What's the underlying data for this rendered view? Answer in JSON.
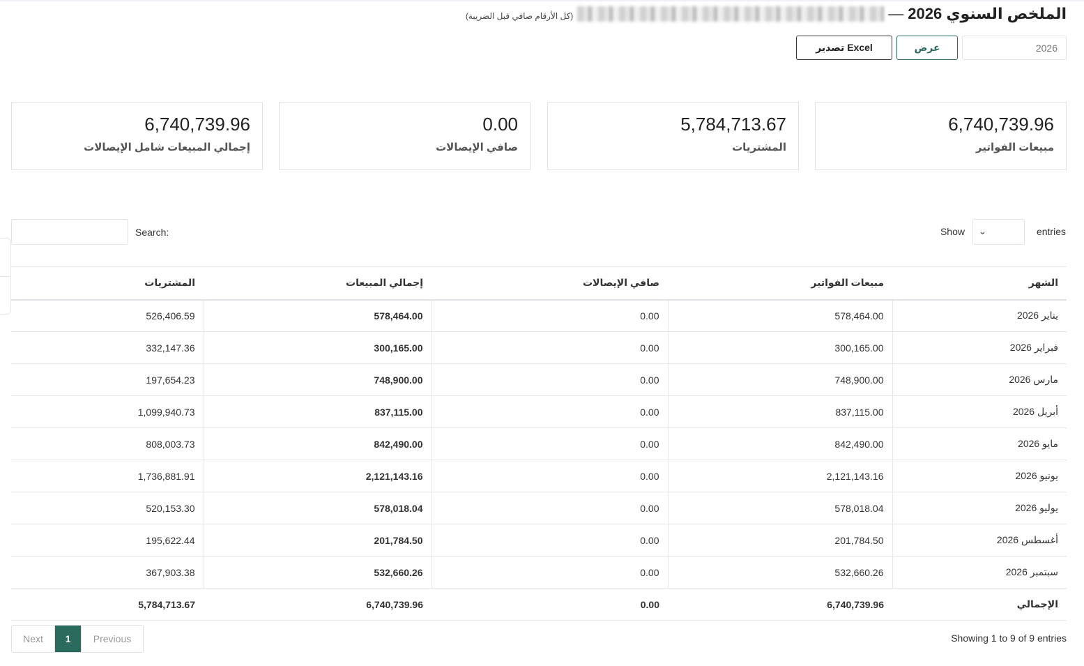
{
  "header": {
    "title": "الملخص السنوي 2026",
    "dash": "—",
    "note": "(كل الأرقام صافي قبل الضريبة)"
  },
  "controls": {
    "year_value": "2026",
    "view_label": "عرض",
    "export_label": "تصدير Excel"
  },
  "cards": [
    {
      "value": "6,740,739.96",
      "label": "مبيعات الفواتير"
    },
    {
      "value": "5,784,713.67",
      "label": "المشتريات"
    },
    {
      "value": "0.00",
      "label": "صافي الإيصالات"
    },
    {
      "value": "6,740,739.96",
      "label": "إجمالي المبيعات شامل الإيصالات"
    }
  ],
  "table_controls": {
    "show": "Show",
    "entries": "entries",
    "search": "Search:"
  },
  "table": {
    "headers": [
      "الشهر",
      "مبيعات الفواتير",
      "صافي الإيصالات",
      "إجمالي المبيعات",
      "المشتريات"
    ],
    "rows": [
      [
        "يناير 2026",
        "578,464.00",
        "0.00",
        "578,464.00",
        "526,406.59"
      ],
      [
        "فبراير 2026",
        "300,165.00",
        "0.00",
        "300,165.00",
        "332,147.36"
      ],
      [
        "مارس 2026",
        "748,900.00",
        "0.00",
        "748,900.00",
        "197,654.23"
      ],
      [
        "أبريل 2026",
        "837,115.00",
        "0.00",
        "837,115.00",
        "1,099,940.73"
      ],
      [
        "مايو 2026",
        "842,490.00",
        "0.00",
        "842,490.00",
        "808,003.73"
      ],
      [
        "يونيو 2026",
        "2,121,143.16",
        "0.00",
        "2,121,143.16",
        "1,736,881.91"
      ],
      [
        "يوليو 2026",
        "578,018.04",
        "0.00",
        "578,018.04",
        "520,153.30"
      ],
      [
        "أغسطس 2026",
        "201,784.50",
        "0.00",
        "201,784.50",
        "195,622.44"
      ],
      [
        "سبتمبر 2026",
        "532,660.26",
        "0.00",
        "532,660.26",
        "367,903.38"
      ]
    ],
    "total": [
      "الإجمالي",
      "6,740,739.96",
      "0.00",
      "6,740,739.96",
      "5,784,713.67"
    ]
  },
  "footer": {
    "showing": "Showing 1 to 9 of 9 entries",
    "next": "Next",
    "page": "1",
    "previous": "Previous"
  }
}
